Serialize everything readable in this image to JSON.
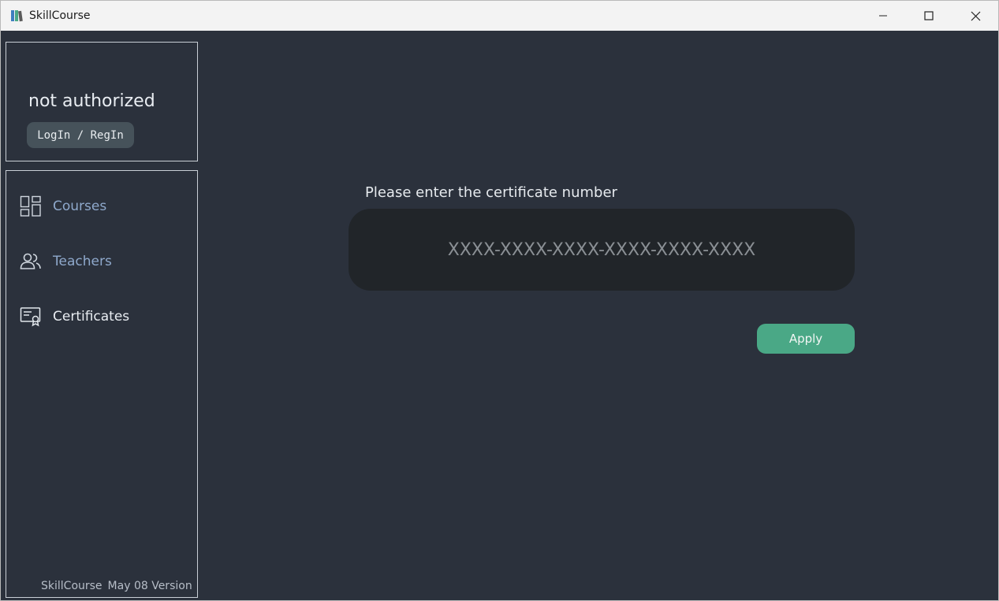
{
  "window": {
    "title": "SkillCourse",
    "controls": [
      "minimize-icon",
      "maximize-icon",
      "close-icon"
    ]
  },
  "auth": {
    "status": "not authorized",
    "login_button": "LogIn / RegIn"
  },
  "sidebar": {
    "items": [
      {
        "label": "Courses",
        "icon": "grid-icon",
        "active": false
      },
      {
        "label": "Teachers",
        "icon": "people-icon",
        "active": false
      },
      {
        "label": "Certificates",
        "icon": "certificate-icon",
        "active": true
      }
    ],
    "footer": {
      "app_name": "SkillCourse",
      "version": "May 08 Version"
    }
  },
  "main": {
    "prompt": "Please enter the certificate number",
    "input_placeholder": "XXXX-XXXX-XXXX-XXXX-XXXX-XXXX",
    "input_value": "",
    "apply_button": "Apply"
  },
  "colors": {
    "background": "#2b313c",
    "accent": "#4aa886",
    "nav_inactive": "#8fa9cc",
    "input_bg": "#212529"
  }
}
